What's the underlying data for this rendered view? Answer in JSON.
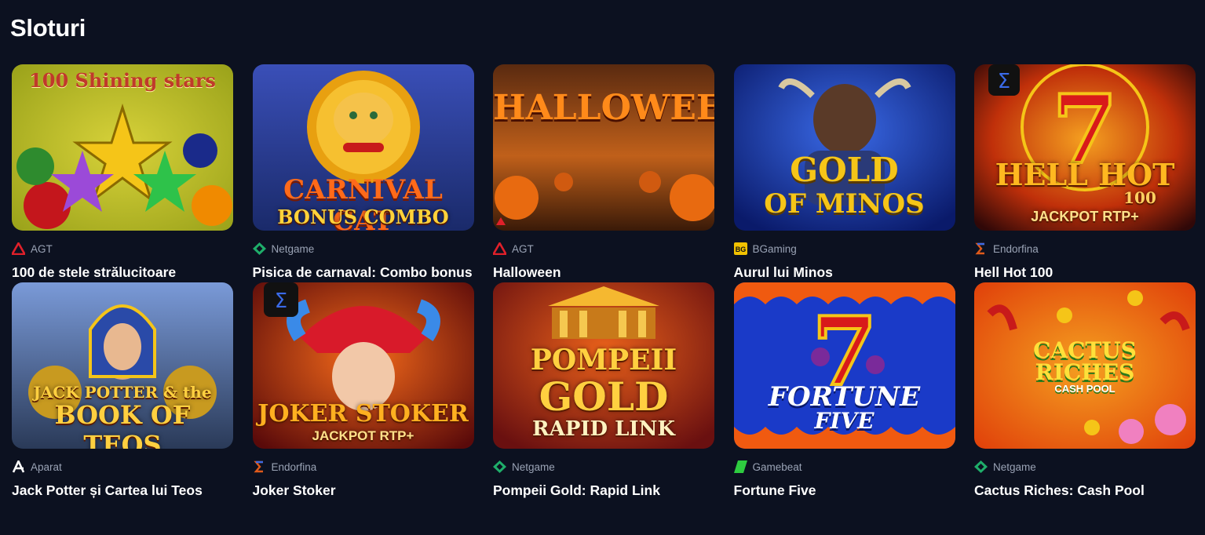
{
  "section": {
    "title": "Sloturi"
  },
  "games": [
    {
      "name": "100 de stele strălucitoare",
      "provider": "AGT",
      "provider_icon": "agt-icon",
      "art_text": [
        "100 Shining stars"
      ]
    },
    {
      "name": "Pisica de carnaval: Combo bonus",
      "provider": "Netgame",
      "provider_icon": "netgame-icon",
      "art_text": [
        "CARNIVAL CAT",
        "BONUS COMBO"
      ]
    },
    {
      "name": "Halloween",
      "provider": "AGT",
      "provider_icon": "agt-icon",
      "art_text": [
        "HALLOWEEN"
      ]
    },
    {
      "name": "Aurul lui Minos",
      "provider": "BGaming",
      "provider_icon": "bgaming-icon",
      "art_text": [
        "GOLD",
        "OF MINOS"
      ]
    },
    {
      "name": "Hell Hot 100",
      "provider": "Endorfina",
      "provider_icon": "endorfina-icon",
      "art_text": [
        "HELL HOT",
        "100",
        "JACKPOT RTP+"
      ]
    },
    {
      "name": "Jack Potter și Cartea lui Teos",
      "provider": "Aparat",
      "provider_icon": "aparat-icon",
      "art_text": [
        "JACK POTTER & the",
        "BOOK OF TEOS"
      ]
    },
    {
      "name": "Joker Stoker",
      "provider": "Endorfina",
      "provider_icon": "endorfina-icon",
      "art_text": [
        "JOKER STOKER",
        "JACKPOT RTP+"
      ]
    },
    {
      "name": "Pompeii Gold: Rapid Link",
      "provider": "Netgame",
      "provider_icon": "netgame-icon",
      "art_text": [
        "POMPEII",
        "GOLD",
        "RAPID LINK"
      ]
    },
    {
      "name": "Fortune Five",
      "provider": "Gamebeat",
      "provider_icon": "gamebeat-icon",
      "art_text": [
        "FORTUNE",
        "FIVE"
      ]
    },
    {
      "name": "Cactus Riches: Cash Pool",
      "provider": "Netgame",
      "provider_icon": "netgame-icon",
      "art_text": [
        "CACTUS",
        "RICHES",
        "CASH POOL"
      ]
    }
  ],
  "colors": {
    "background": "#0c1120",
    "provider_text": "#9aa3b5",
    "agt_red": "#e0202a",
    "netgame_green": "#1fae6a",
    "bgaming_yellow": "#f2c200",
    "gamebeat_green": "#2ecc40"
  }
}
